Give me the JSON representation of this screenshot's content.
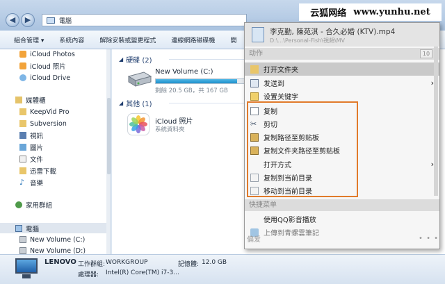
{
  "watermark": {
    "brand": "云狐网络",
    "url": "www.yunhu.net"
  },
  "address_bar": {
    "path": "電腦"
  },
  "toolbar": {
    "items": [
      "組合管理 ▾",
      "系統內容",
      "解除安裝或變更程式",
      "連線網路磁碟機",
      "開"
    ]
  },
  "sidebar": {
    "items": [
      {
        "label": "iCloud Photos",
        "icon": "photos-icon"
      },
      {
        "label": "iCloud 照片",
        "icon": "photos-icon"
      },
      {
        "label": "iCloud Drive",
        "icon": "cloud-icon"
      },
      {
        "label": "媒體櫃",
        "icon": "library-icon"
      },
      {
        "label": "KeepVid Pro",
        "icon": "folder-icon"
      },
      {
        "label": "Subversion",
        "icon": "folder-icon"
      },
      {
        "label": "視訊",
        "icon": "video-icon"
      },
      {
        "label": "圖片",
        "icon": "picture-icon"
      },
      {
        "label": "文件",
        "icon": "document-icon"
      },
      {
        "label": "迅雷下載",
        "icon": "folder-icon"
      },
      {
        "label": "音樂",
        "icon": "music-icon"
      },
      {
        "label": "家用群組",
        "icon": "homegroup-icon"
      },
      {
        "label": "電腦",
        "icon": "computer-icon"
      },
      {
        "label": "New Volume (C:)",
        "icon": "drive-icon"
      },
      {
        "label": "New Volume (D:)",
        "icon": "drive-icon"
      }
    ]
  },
  "main": {
    "hdd_group": "硬碟 (2)",
    "other_group": "其他 (1)",
    "drive": {
      "name": "New Volume (C:)",
      "free_text": "剩餘 20.5 GB，共 167 GB",
      "used_fraction": 0.88
    },
    "photos": {
      "name": "iCloud 照片",
      "sub": "系統資料夾"
    }
  },
  "statusbar": {
    "name": "LENOVO",
    "workgroup_label": "工作群組:",
    "workgroup": "WORKGROUP",
    "memory_label": "記憶體:",
    "memory": "12.0 GB",
    "cpu_label": "處理器:",
    "cpu": "Intel(R) Core(TM) i7-3..."
  },
  "context_menu": {
    "file_title": "李克勤, 陳苑淇 - 合久必婚 (KTV).mp4",
    "file_path": "D:\\...\\Personal-Fish\\視頻\\MV",
    "section_actions": "动作",
    "action_count": "10",
    "items": [
      {
        "label": "打开文件夹",
        "icon": "folder-open-icon",
        "highlight": true
      },
      {
        "label": "发送到",
        "icon": "send-icon",
        "submenu": true
      },
      {
        "label": "设置关键字",
        "icon": "tag-icon"
      },
      {
        "label": "复制",
        "icon": "copy-icon"
      },
      {
        "label": "剪切",
        "icon": "cut-icon"
      },
      {
        "label": "复制路径至剪贴板",
        "icon": "clipboard-icon"
      },
      {
        "label": "复制文件夹路径至剪贴板",
        "icon": "clipboard-icon"
      },
      {
        "label": "打开方式",
        "icon": "",
        "submenu": true
      },
      {
        "label": "复制到当前目录",
        "icon": "copy-here-icon"
      },
      {
        "label": "移动到当前目录",
        "icon": "move-here-icon"
      }
    ],
    "section_quick": "快捷菜单",
    "quick_items": [
      {
        "label": "使用QQ影音播放",
        "icon": ""
      },
      {
        "label": "上傳到青螺雲筆記",
        "icon": "cloud-note-icon"
      }
    ],
    "bottom_label": "偏爱"
  }
}
